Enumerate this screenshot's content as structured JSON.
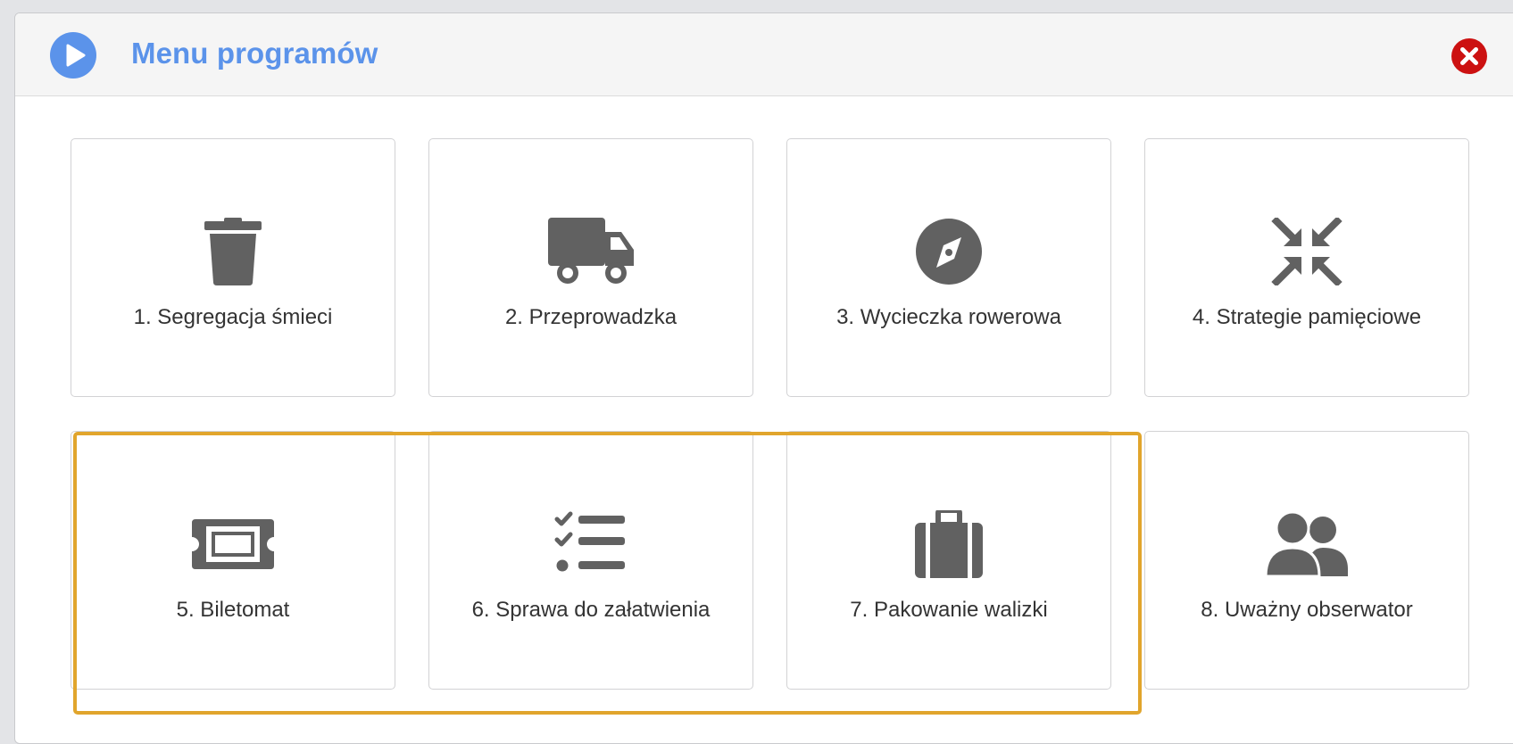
{
  "window": {
    "title": "Menu programów",
    "accent_color": "#5b93ea",
    "close_color": "#cc1111",
    "icons": {
      "header": "play-circle-icon",
      "close": "close-circle-icon"
    }
  },
  "tiles": [
    {
      "label": "1. Segregacja śmieci",
      "icon": "trash-icon"
    },
    {
      "label": "2. Przeprowadzka",
      "icon": "truck-icon"
    },
    {
      "label": "3. Wycieczka rowerowa",
      "icon": "compass-icon"
    },
    {
      "label": "4. Strategie pamięciowe",
      "icon": "compress-arrows-icon"
    },
    {
      "label": "5. Biletomat",
      "icon": "ticket-icon"
    },
    {
      "label": "6. Sprawa do załatwienia",
      "icon": "checklist-icon"
    },
    {
      "label": "7. Pakowanie walizki",
      "icon": "suitcase-icon"
    },
    {
      "label": "8. Uważny obserwator",
      "icon": "users-icon"
    }
  ],
  "highlight_color": "#e1a52c"
}
